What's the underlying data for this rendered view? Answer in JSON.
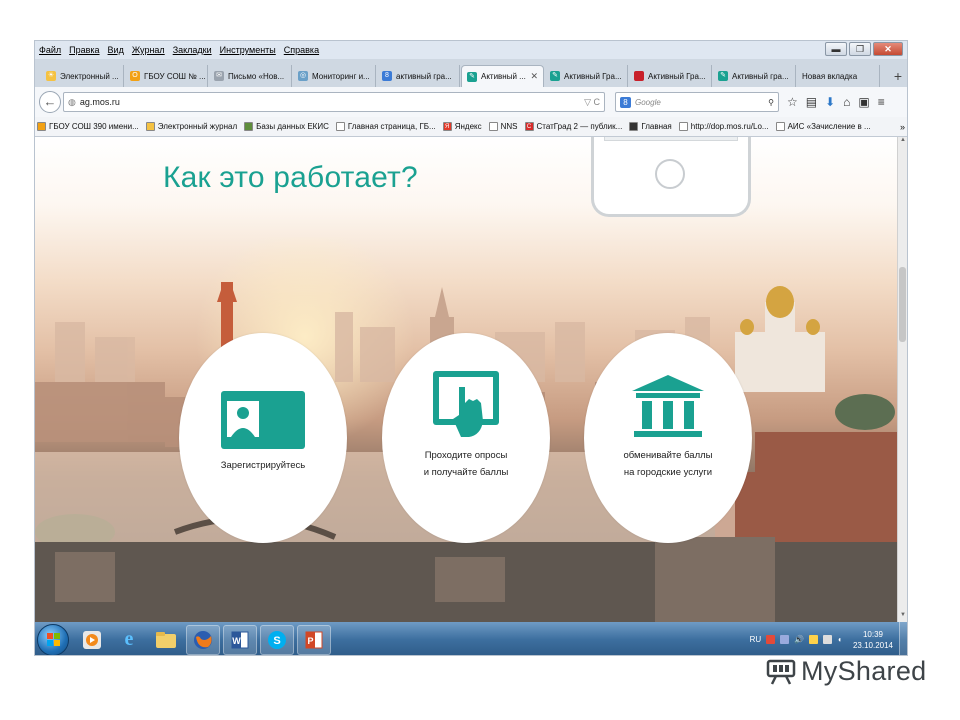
{
  "menubar": {
    "items": [
      "Файл",
      "Правка",
      "Вид",
      "Журнал",
      "Закладки",
      "Инструменты",
      "Справка"
    ]
  },
  "tabs": [
    {
      "label": "Электронный ...",
      "active": false,
      "icon": "sun-favicon"
    },
    {
      "label": "ГБОУ СОШ № ...",
      "active": false,
      "icon": "school-favicon"
    },
    {
      "label": "Письмо «Нов...",
      "active": false,
      "icon": "mail-favicon"
    },
    {
      "label": "Мониторинг и...",
      "active": false,
      "icon": "monitor-favicon"
    },
    {
      "label": "активный гра...",
      "active": false,
      "icon": "google-favicon"
    },
    {
      "label": "Активный ...",
      "active": true,
      "icon": "ag-favicon"
    },
    {
      "label": "Активный Гра...",
      "active": false,
      "icon": "ag-favicon"
    },
    {
      "label": "Активный Гра...",
      "active": false,
      "icon": "red-favicon"
    },
    {
      "label": "Активный гра...",
      "active": false,
      "icon": "ag-favicon"
    },
    {
      "label": "Новая вкладка",
      "active": false,
      "icon": "none"
    }
  ],
  "navbar": {
    "url": "ag.mos.ru",
    "search_placeholder": "Google",
    "search_engine_letter": "8"
  },
  "bookmarks": [
    {
      "label": "ГБОУ СОШ 390 имени...",
      "color": "#f2a114"
    },
    {
      "label": "Электронный журнал",
      "color": "#f5c242"
    },
    {
      "label": "Базы данных ЕКИС",
      "color": "#5f8d3c"
    },
    {
      "label": "Главная страница, ГБ...",
      "color": "#ffffff"
    },
    {
      "label": "Яндекс",
      "color": "#e23a2a"
    },
    {
      "label": "NNS",
      "color": "#ffffff"
    },
    {
      "label": "СтатГрад 2 — публик...",
      "color": "#d72b2b"
    },
    {
      "label": "Главная",
      "color": "#333333"
    },
    {
      "label": "http://dop.mos.ru/Lo...",
      "color": "#ffffff"
    },
    {
      "label": "АИС «Зачисление в ...",
      "color": "#ffffff"
    }
  ],
  "page": {
    "heading": "Как это работает?",
    "accent_color": "#1aa191",
    "steps": [
      {
        "caption_line1": "Зарегистрируйтесь",
        "caption_line2": "",
        "icon": "id-card-icon"
      },
      {
        "caption_line1": "Проходите опросы",
        "caption_line2": "и получайте баллы",
        "icon": "tablet-touch-icon"
      },
      {
        "caption_line1": "обменивайте баллы",
        "caption_line2": "на городские услуги",
        "icon": "government-building-icon"
      }
    ]
  },
  "taskbar": {
    "language": "RU",
    "time": "10:39",
    "date": "23.10.2014"
  },
  "watermark": {
    "text": "MyShared"
  }
}
